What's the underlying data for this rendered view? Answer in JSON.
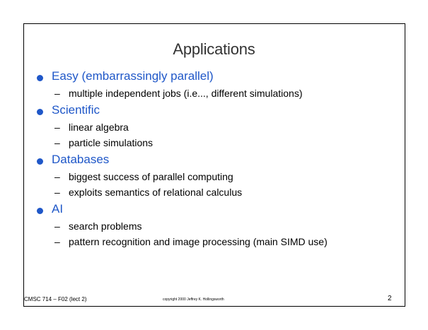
{
  "slide": {
    "title": "Applications",
    "bullets": [
      {
        "label": "Easy (embarrassingly parallel)",
        "subs": [
          "multiple independent jobs (i.e..., different simulations)"
        ]
      },
      {
        "label": "Scientific",
        "subs": [
          "linear algebra",
          "particle simulations"
        ]
      },
      {
        "label": "Databases",
        "subs": [
          "biggest success of parallel computing",
          "exploits semantics of relational calculus"
        ]
      },
      {
        "label": "AI",
        "subs": [
          "search problems",
          "pattern recognition and image processing (main SIMD use)"
        ]
      }
    ],
    "dash": "–",
    "footer_left": "CMSC 714 – F02  (lect 2)",
    "footer_center": "copyright 2000  Jeffrey K. Hollingsworth",
    "page_number": "2"
  },
  "colors": {
    "bullet_accent": "#1f57c8",
    "title_text": "#333333",
    "body_text": "#000000"
  }
}
